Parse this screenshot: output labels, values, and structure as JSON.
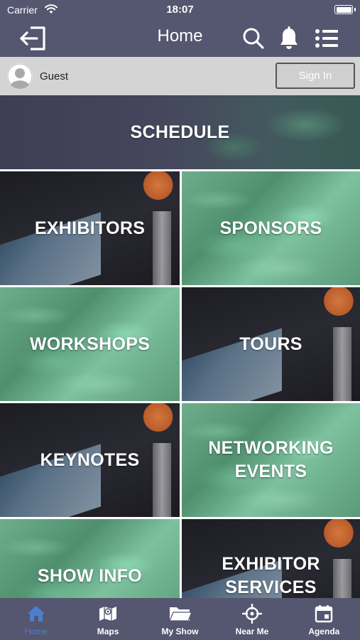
{
  "status_bar": {
    "carrier": "Carrier",
    "time": "18:07"
  },
  "nav": {
    "title": "Home"
  },
  "user": {
    "name": "Guest",
    "sign_in_label": "Sign In"
  },
  "tiles": [
    {
      "id": "schedule",
      "label": "SCHEDULE",
      "style": "schedule"
    },
    {
      "id": "exhibitors",
      "label": "EXHIBITORS",
      "style": "dark"
    },
    {
      "id": "sponsors",
      "label": "SPONSORS",
      "style": "green"
    },
    {
      "id": "workshops",
      "label": "WORKSHOPS",
      "style": "green"
    },
    {
      "id": "tours",
      "label": "TOURS",
      "style": "dark"
    },
    {
      "id": "keynotes",
      "label": "KEYNOTES",
      "style": "dark"
    },
    {
      "id": "networking-events",
      "label": "NETWORKING\nEVENTS",
      "style": "green"
    },
    {
      "id": "show-info",
      "label": "SHOW INFO",
      "style": "green"
    },
    {
      "id": "exhibitor-services",
      "label": "EXHIBITOR\nSERVICES",
      "style": "dark"
    }
  ],
  "tab_bar": {
    "items": [
      {
        "label": "Home",
        "icon": "home-icon",
        "active": true
      },
      {
        "label": "Maps",
        "icon": "map-icon",
        "active": false
      },
      {
        "label": "My Show",
        "icon": "folder-icon",
        "active": false
      },
      {
        "label": "Near Me",
        "icon": "crosshair-icon",
        "active": false
      },
      {
        "label": "Agenda",
        "icon": "calendar-icon",
        "active": false
      }
    ]
  },
  "colors": {
    "bar_background": "#55566f",
    "user_bar_background": "#d4d4d4",
    "active_tab": "#4a7fd0",
    "inactive_tab": "#ffffff"
  }
}
